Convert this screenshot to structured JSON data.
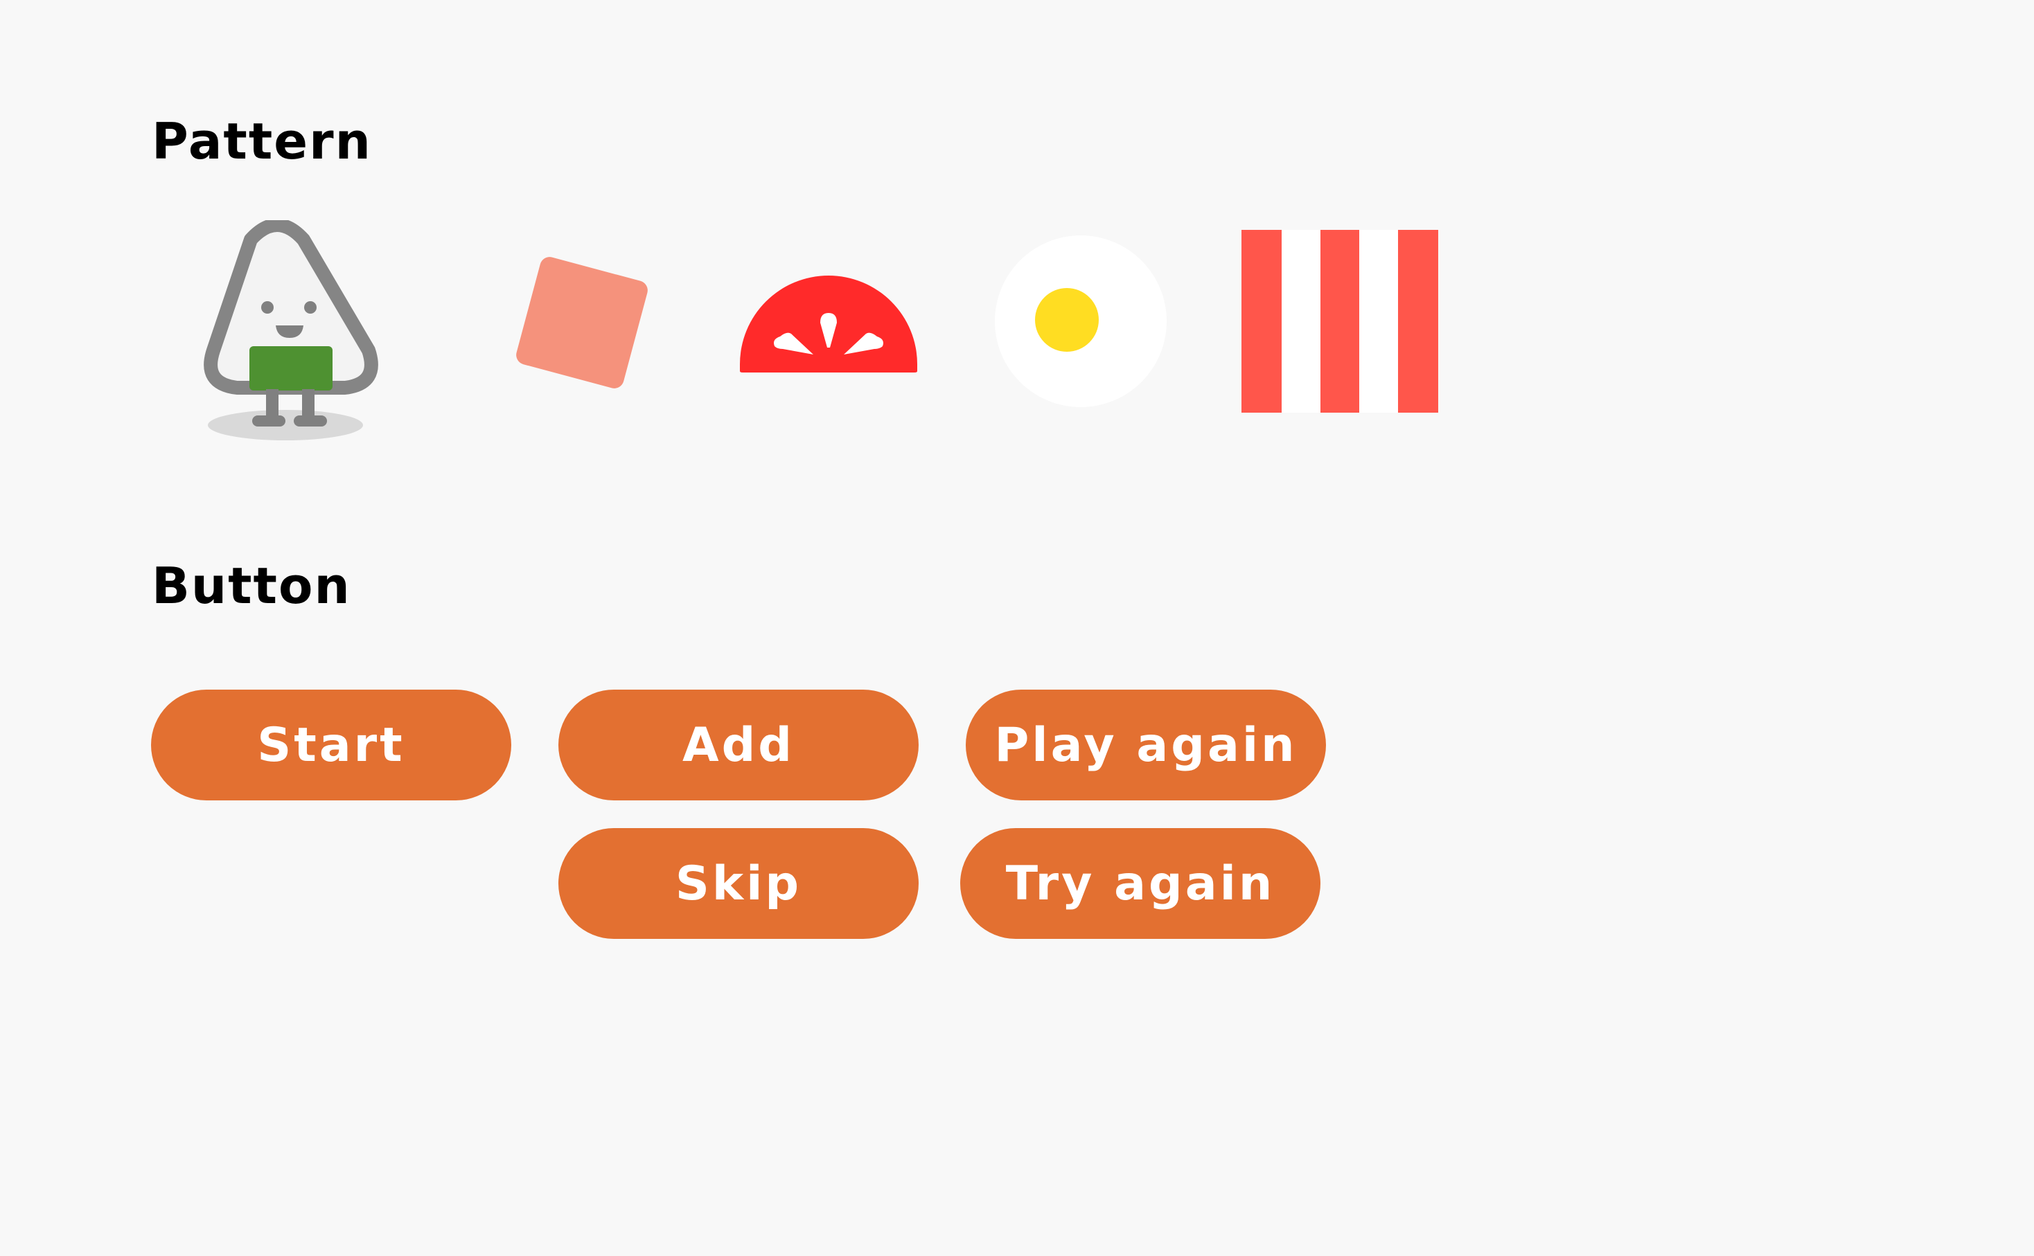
{
  "sections": {
    "pattern_title": "Pattern",
    "button_title": "Button"
  },
  "patterns": [
    {
      "name": "onigiri-character-icon"
    },
    {
      "name": "salmon-slice-icon"
    },
    {
      "name": "tomato-slice-icon"
    },
    {
      "name": "fried-egg-icon"
    },
    {
      "name": "bacon-stripes-icon"
    }
  ],
  "buttons": {
    "start": "Start",
    "add": "Add",
    "play_again": "Play again",
    "skip": "Skip",
    "try_again": "Try again"
  },
  "colors": {
    "background": "#f8f8f8",
    "button": "#e37031",
    "button_text": "#ffffff",
    "salmon": "#f5927c",
    "tomato": "#ff2a2a",
    "bacon": "#ff564b",
    "egg_yolk": "#ffdd22",
    "nori": "#4e9131",
    "outline": "#808080"
  }
}
